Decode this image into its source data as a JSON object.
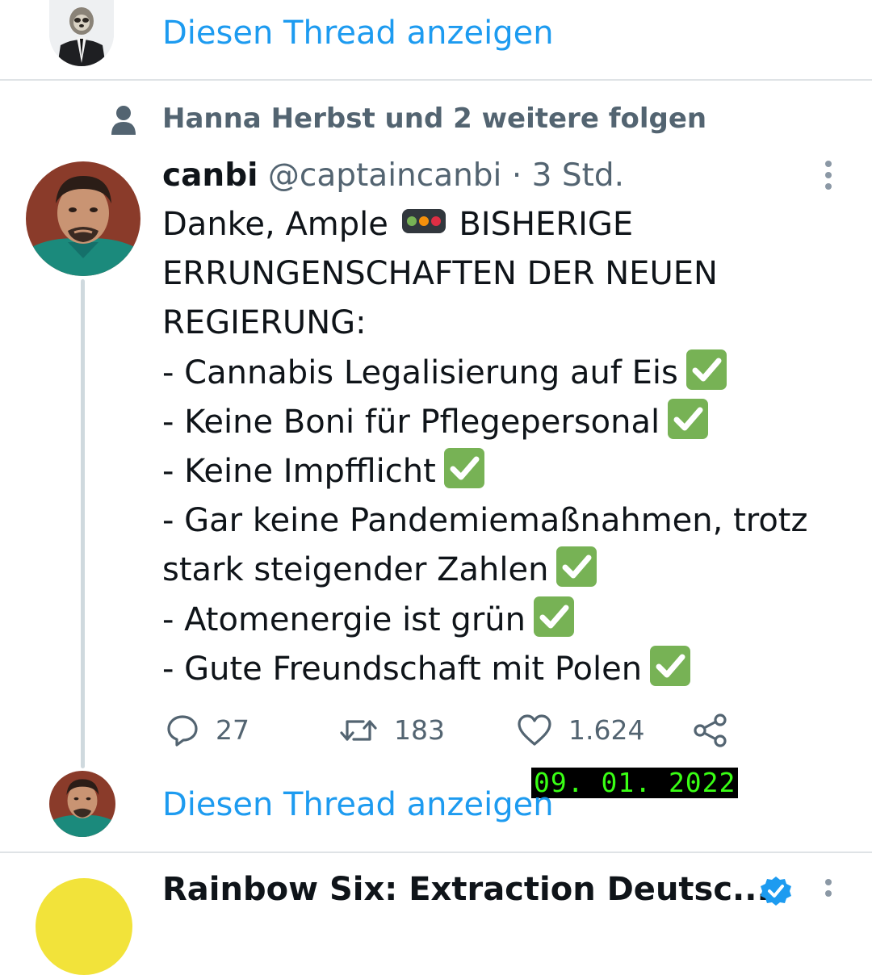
{
  "top_thread": {
    "show_thread_label": "Diesen Thread anzeigen",
    "avatar_icon": "sloth-in-suit-avatar"
  },
  "tweet": {
    "social_context": "Hanna Herbst und 2 weitere folgen",
    "author_name": "canbi",
    "author_handle": "@captaincanbi",
    "separator": "·",
    "time": "3 Std.",
    "lines": [
      {
        "text": "Danke, Ample",
        "after_icon": "traffic-light-emoji",
        "after_text": "BISHERIGE"
      },
      {
        "text": "ERRUNGENSCHAFTEN DER NEUEN"
      },
      {
        "text": "REGIERUNG:"
      },
      {
        "text": "- Cannabis Legalisierung auf Eis",
        "check": true
      },
      {
        "text": "- Keine Boni für Pflegepersonal",
        "check": true
      },
      {
        "text": "- Keine Impfflicht",
        "check": true
      },
      {
        "text": "- Gar keine Pandemiemaßnahmen, trotz"
      },
      {
        "text": "stark steigender Zahlen",
        "check": true
      },
      {
        "text": "- Atomenergie ist grün",
        "check": true
      },
      {
        "text": "- Gute Freundschaft mit Polen",
        "check": true
      }
    ],
    "actions": {
      "replies": "27",
      "retweets": "183",
      "likes": "1.624"
    },
    "show_thread_label": "Diesen Thread anzeigen"
  },
  "overlay": {
    "date_stamp": "09. 01. 2022"
  },
  "next_tweet": {
    "author_name": "Rainbow Six: Extraction Deutsc...",
    "verified": true
  },
  "colors": {
    "link": "#1d9bf0",
    "muted": "#536471",
    "check_bg": "#77b255",
    "stamp_text": "#39ff14"
  }
}
